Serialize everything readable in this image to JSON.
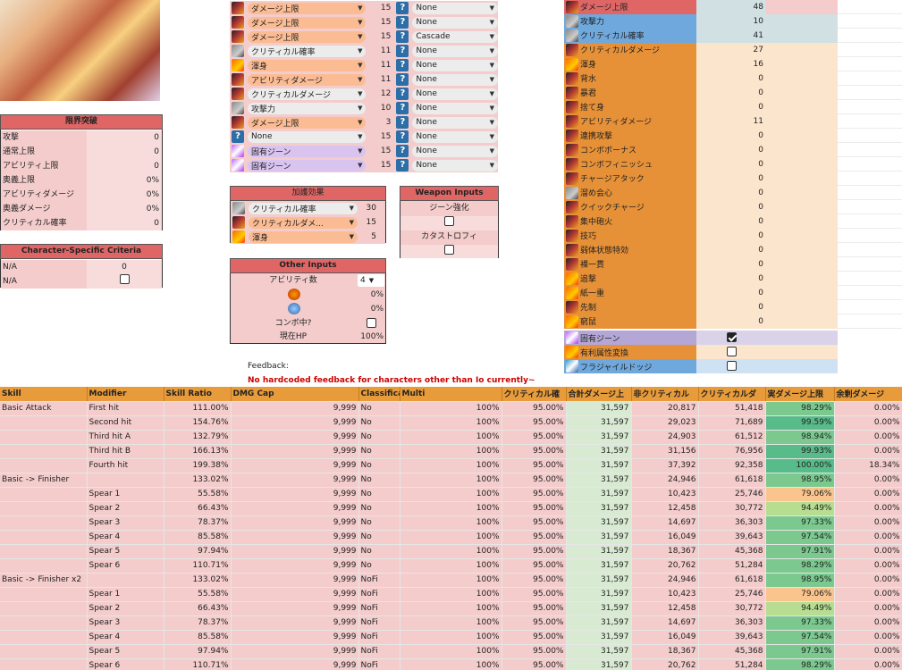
{
  "limit_break": {
    "title": "限界突破",
    "rows": [
      {
        "label": "攻撃",
        "value": "0"
      },
      {
        "label": "通常上限",
        "value": "0"
      },
      {
        "label": "アビリティ上限",
        "value": "0"
      },
      {
        "label": "奥義上限",
        "value": "0%"
      },
      {
        "label": "アビリティダメージ",
        "value": "0%"
      },
      {
        "label": "奥義ダメージ",
        "value": "0%"
      },
      {
        "label": "クリティカル確率",
        "value": "0"
      }
    ]
  },
  "criteria": {
    "title": "Character-Specific Criteria",
    "rows": [
      {
        "label": "N/A",
        "value": "0",
        "type": "num"
      },
      {
        "label": "N/A",
        "value": "",
        "type": "check"
      }
    ]
  },
  "skills": [
    {
      "icon": "r",
      "name": "ダメージ上限",
      "dd": "o",
      "lv": "15",
      "opt": "None"
    },
    {
      "icon": "r",
      "name": "ダメージ上限",
      "dd": "o",
      "lv": "15",
      "opt": "None"
    },
    {
      "icon": "r",
      "name": "ダメージ上限",
      "dd": "o",
      "lv": "15",
      "opt": "Cascade"
    },
    {
      "icon": "g",
      "name": "クリティカル確率",
      "dd": "g",
      "lv": "11",
      "opt": "None"
    },
    {
      "icon": "o",
      "name": "渾身",
      "dd": "o",
      "lv": "11",
      "opt": "None"
    },
    {
      "icon": "r",
      "name": "アビリティダメージ",
      "dd": "o",
      "lv": "11",
      "opt": "None"
    },
    {
      "icon": "r",
      "name": "クリティカルダメージ",
      "dd": "g",
      "lv": "12",
      "opt": "None"
    },
    {
      "icon": "g",
      "name": "攻撃力",
      "dd": "g",
      "lv": "10",
      "opt": "None"
    },
    {
      "icon": "r",
      "name": "ダメージ上限",
      "dd": "o",
      "lv": "3",
      "opt": "None"
    },
    {
      "icon": "q",
      "name": "None",
      "dd": "g",
      "lv": "15",
      "opt": "None"
    },
    {
      "icon": "p",
      "name": "固有ジーン",
      "dd": "p",
      "lv": "15",
      "opt": "None"
    },
    {
      "icon": "p",
      "name": "固有ジーン",
      "dd": "p",
      "lv": "15",
      "opt": "None"
    }
  ],
  "support": {
    "title": "加護効果",
    "rows": [
      {
        "icon": "g",
        "name": "クリティカル確率",
        "dd": "g",
        "value": "30"
      },
      {
        "icon": "r",
        "name": "クリティカルダメ...",
        "dd": "o",
        "value": "15"
      },
      {
        "icon": "o",
        "name": "渾身",
        "dd": "o",
        "value": "5"
      }
    ]
  },
  "weapon": {
    "title": "Weapon Inputs",
    "gene_label": "ジーン強化",
    "cata_label": "カタストロフィ"
  },
  "other": {
    "title": "Other Inputs",
    "abil_label": "アビリティ数",
    "abil_value": "4",
    "pct1": "0%",
    "pct2": "0%",
    "combo_label": "コンボ中?",
    "hp_label": "現在HP",
    "hp_value": "100%"
  },
  "feedback": {
    "label": "Feedback:",
    "text": "No hardcoded feedback for characters other than Io currently~"
  },
  "stats": [
    {
      "icon": "r",
      "name": "ダメージ上限",
      "value": "48",
      "color": "#e06666"
    },
    {
      "icon": "g",
      "name": "攻撃力",
      "value": "10",
      "color": "#6fa8dc"
    },
    {
      "icon": "g",
      "name": "クリティカル確率",
      "value": "41",
      "color": "#6fa8dc"
    },
    {
      "icon": "r",
      "name": "クリティカルダメージ",
      "value": "27",
      "color": "#e69138"
    },
    {
      "icon": "o",
      "name": "渾身",
      "value": "16",
      "color": "#e69138"
    },
    {
      "icon": "r",
      "name": "背水",
      "value": "0",
      "color": "#e69138"
    },
    {
      "icon": "r",
      "name": "暴君",
      "value": "0",
      "color": "#e69138"
    },
    {
      "icon": "r",
      "name": "捨て身",
      "value": "0",
      "color": "#e69138"
    },
    {
      "icon": "r",
      "name": "アビリティダメージ",
      "value": "11",
      "color": "#e69138"
    },
    {
      "icon": "r",
      "name": "連携攻撃",
      "value": "0",
      "color": "#e69138"
    },
    {
      "icon": "r",
      "name": "コンボボーナス",
      "value": "0",
      "color": "#e69138"
    },
    {
      "icon": "r",
      "name": "コンボフィニッシュ",
      "value": "0",
      "color": "#e69138"
    },
    {
      "icon": "r",
      "name": "チャージアタック",
      "value": "0",
      "color": "#e69138"
    },
    {
      "icon": "g",
      "name": "溜め会心",
      "value": "0",
      "color": "#e69138"
    },
    {
      "icon": "r",
      "name": "クイックチャージ",
      "value": "0",
      "color": "#e69138"
    },
    {
      "icon": "r",
      "name": "集中砲火",
      "value": "0",
      "color": "#e69138"
    },
    {
      "icon": "r",
      "name": "技巧",
      "value": "0",
      "color": "#e69138"
    },
    {
      "icon": "r",
      "name": "弱体状態特効",
      "value": "0",
      "color": "#e69138"
    },
    {
      "icon": "r",
      "name": "裸一貫",
      "value": "0",
      "color": "#e69138"
    },
    {
      "icon": "o",
      "name": "追撃",
      "value": "0",
      "color": "#e69138"
    },
    {
      "icon": "o",
      "name": "紙一重",
      "value": "0",
      "color": "#e69138"
    },
    {
      "icon": "r",
      "name": "先制",
      "value": "0",
      "color": "#e69138"
    },
    {
      "icon": "o",
      "name": "窮鼠",
      "value": "0",
      "color": "#e69138"
    }
  ],
  "stat_checks": [
    {
      "icon": "p",
      "name": "固有ジーン",
      "checked": true,
      "color": "#b4a7d6"
    },
    {
      "icon": "o",
      "name": "有利属性変換",
      "checked": false,
      "color": "#e69138"
    },
    {
      "icon": "b",
      "name": "フラジャイルドッジ",
      "checked": false,
      "color": "#6fa8dc"
    }
  ],
  "table": {
    "headers": [
      "Skill",
      "Modifier",
      "Skill Ratio",
      "DMG Cap",
      "Classifica",
      "Multi",
      "クリティカル確",
      "合計ダメージ上",
      "非クリティカル",
      "クリティカルダ",
      "実ダメージ上限",
      "余剰ダメージ"
    ],
    "rows": [
      [
        "Basic Attack",
        "First hit",
        "111.00%",
        "9,999",
        "No",
        "100%",
        "95.00%",
        "31,597",
        "20,817",
        "51,418",
        "98.29%",
        "0.00%",
        "g"
      ],
      [
        "",
        "Second hit",
        "154.76%",
        "9,999",
        "No",
        "100%",
        "95.00%",
        "31,597",
        "29,023",
        "71,689",
        "99.59%",
        "0.00%",
        "g"
      ],
      [
        "",
        "Third hit A",
        "132.79%",
        "9,999",
        "No",
        "100%",
        "95.00%",
        "31,597",
        "24,903",
        "61,512",
        "98.94%",
        "0.00%",
        "g"
      ],
      [
        "",
        "Third hit B",
        "166.13%",
        "9,999",
        "No",
        "100%",
        "95.00%",
        "31,597",
        "31,156",
        "76,956",
        "99.93%",
        "0.00%",
        "g"
      ],
      [
        "",
        "Fourth hit",
        "199.38%",
        "9,999",
        "No",
        "100%",
        "95.00%",
        "31,597",
        "37,392",
        "92,358",
        "100.00%",
        "18.34%",
        "g"
      ],
      [
        "Basic -> Finisher",
        "",
        "133.02%",
        "9,999",
        "No",
        "100%",
        "95.00%",
        "31,597",
        "24,946",
        "61,618",
        "98.95%",
        "0.00%",
        "g"
      ],
      [
        "",
        "Spear 1",
        "55.58%",
        "9,999",
        "No",
        "100%",
        "95.00%",
        "31,597",
        "10,423",
        "25,746",
        "79.06%",
        "0.00%",
        "o"
      ],
      [
        "",
        "Spear 2",
        "66.43%",
        "9,999",
        "No",
        "100%",
        "95.00%",
        "31,597",
        "12,458",
        "30,772",
        "94.49%",
        "0.00%",
        "y"
      ],
      [
        "",
        "Spear 3",
        "78.37%",
        "9,999",
        "No",
        "100%",
        "95.00%",
        "31,597",
        "14,697",
        "36,303",
        "97.33%",
        "0.00%",
        "g"
      ],
      [
        "",
        "Spear 4",
        "85.58%",
        "9,999",
        "No",
        "100%",
        "95.00%",
        "31,597",
        "16,049",
        "39,643",
        "97.54%",
        "0.00%",
        "g"
      ],
      [
        "",
        "Spear 5",
        "97.94%",
        "9,999",
        "No",
        "100%",
        "95.00%",
        "31,597",
        "18,367",
        "45,368",
        "97.91%",
        "0.00%",
        "g"
      ],
      [
        "",
        "Spear 6",
        "110.71%",
        "9,999",
        "No",
        "100%",
        "95.00%",
        "31,597",
        "20,762",
        "51,284",
        "98.29%",
        "0.00%",
        "g"
      ],
      [
        "Basic -> Finisher x2",
        "",
        "133.02%",
        "9,999",
        "NoFi",
        "100%",
        "95.00%",
        "31,597",
        "24,946",
        "61,618",
        "98.95%",
        "0.00%",
        "g"
      ],
      [
        "",
        "Spear 1",
        "55.58%",
        "9,999",
        "NoFi",
        "100%",
        "95.00%",
        "31,597",
        "10,423",
        "25,746",
        "79.06%",
        "0.00%",
        "o"
      ],
      [
        "",
        "Spear 2",
        "66.43%",
        "9,999",
        "NoFi",
        "100%",
        "95.00%",
        "31,597",
        "12,458",
        "30,772",
        "94.49%",
        "0.00%",
        "y"
      ],
      [
        "",
        "Spear 3",
        "78.37%",
        "9,999",
        "NoFi",
        "100%",
        "95.00%",
        "31,597",
        "14,697",
        "36,303",
        "97.33%",
        "0.00%",
        "g"
      ],
      [
        "",
        "Spear 4",
        "85.58%",
        "9,999",
        "NoFi",
        "100%",
        "95.00%",
        "31,597",
        "16,049",
        "39,643",
        "97.54%",
        "0.00%",
        "g"
      ],
      [
        "",
        "Spear 5",
        "97.94%",
        "9,999",
        "NoFi",
        "100%",
        "95.00%",
        "31,597",
        "18,367",
        "45,368",
        "97.91%",
        "0.00%",
        "g"
      ],
      [
        "",
        "Spear 6",
        "110.71%",
        "9,999",
        "NoFi",
        "100%",
        "95.00%",
        "31,597",
        "20,762",
        "51,284",
        "98.29%",
        "0.00%",
        "g"
      ]
    ]
  }
}
